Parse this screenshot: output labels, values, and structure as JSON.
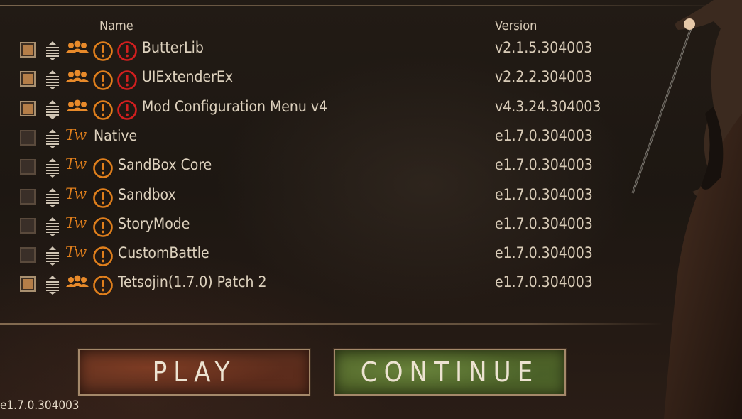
{
  "header": {
    "name": "Name",
    "version": "Version"
  },
  "mods": [
    {
      "name": "ButterLib",
      "version": "v2.1.5.304003",
      "checked": true,
      "source": "community",
      "warn_orange": true,
      "warn_red": true
    },
    {
      "name": "UIExtenderEx",
      "version": "v2.2.2.304003",
      "checked": true,
      "source": "community",
      "warn_orange": true,
      "warn_red": true
    },
    {
      "name": "Mod Configuration Menu v4",
      "version": "v4.3.24.304003",
      "checked": true,
      "source": "community",
      "warn_orange": true,
      "warn_red": true
    },
    {
      "name": "Native",
      "version": "e1.7.0.304003",
      "checked": false,
      "source": "taleworlds",
      "warn_orange": false,
      "warn_red": false
    },
    {
      "name": "SandBox Core",
      "version": "e1.7.0.304003",
      "checked": false,
      "source": "taleworlds",
      "warn_orange": true,
      "warn_red": false
    },
    {
      "name": "Sandbox",
      "version": "e1.7.0.304003",
      "checked": false,
      "source": "taleworlds",
      "warn_orange": true,
      "warn_red": false
    },
    {
      "name": "StoryMode",
      "version": "e1.7.0.304003",
      "checked": false,
      "source": "taleworlds",
      "warn_orange": true,
      "warn_red": false
    },
    {
      "name": "CustomBattle",
      "version": "e1.7.0.304003",
      "checked": false,
      "source": "taleworlds",
      "warn_orange": true,
      "warn_red": false
    },
    {
      "name": "Tetsojin(1.7.0) Patch 2",
      "version": "e1.7.0.304003",
      "checked": true,
      "source": "community",
      "warn_orange": true,
      "warn_red": false
    }
  ],
  "icons": {
    "tw_logo": "Tw",
    "community": "community-icon",
    "drag": "drag-handle-icon",
    "warning": "warning-icon",
    "error": "error-icon"
  },
  "buttons": {
    "play": "PLAY",
    "continue": "CONTINUE"
  },
  "game_version": "e1.7.0.304003",
  "colors": {
    "accent_orange": "#e07f1c",
    "error_red": "#d21f1f",
    "text": "#ddd1bd",
    "checkbox_checked": "#b57e48"
  }
}
